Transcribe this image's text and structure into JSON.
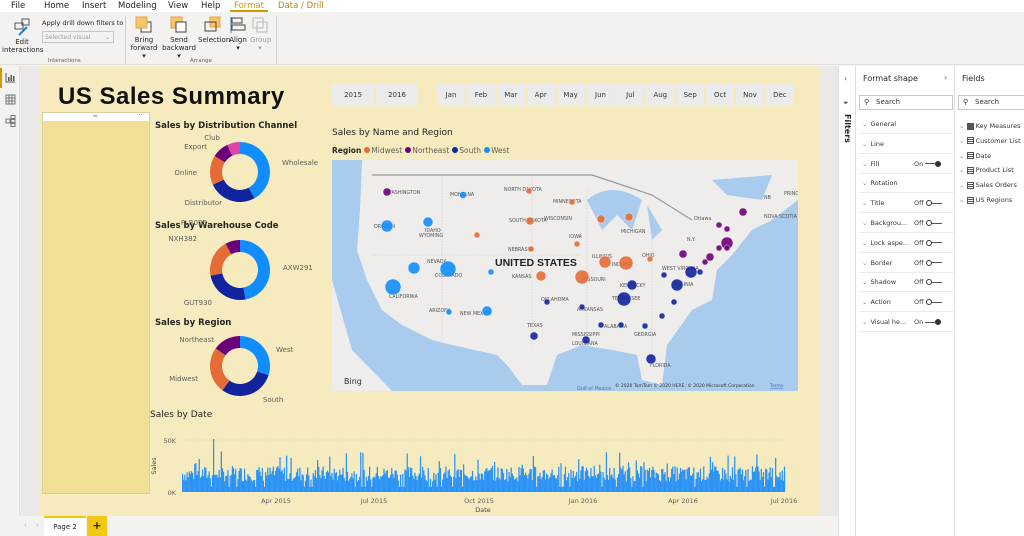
{
  "menu": [
    "File",
    "Home",
    "Insert",
    "Modeling",
    "View",
    "Help",
    "Format",
    "Data / Drill"
  ],
  "ribbon": {
    "edit_interactions": [
      "Edit",
      "interactions"
    ],
    "apply_drill_label": "Apply drill down filters to",
    "apply_drill_value": "Selected visual",
    "group_interactions": "Interactions",
    "bring_forward": [
      "Bring",
      "forward ▾"
    ],
    "send_backward": [
      "Send",
      "backward ▾"
    ],
    "selection": "Selection",
    "align": [
      "Align",
      "▾"
    ],
    "group": [
      "Group",
      "▾"
    ],
    "group_arrange": "Arrange"
  },
  "report": {
    "title": "US Sales Summary",
    "years": [
      "2015",
      "2016"
    ],
    "months": [
      "Jan",
      "Feb",
      "Mar",
      "Apr",
      "May",
      "Jun",
      "Jul",
      "Aug",
      "Sep",
      "Oct",
      "Nov",
      "Dec"
    ]
  },
  "colors": {
    "lightblue": "#118dff",
    "darkblue": "#12239e",
    "orange": "#e66c37",
    "purple": "#6b007b",
    "pink": "#e044a7",
    "page": "#f6ebbe"
  },
  "donuts": [
    {
      "title": "Sales by Distribution Channel",
      "slices": [
        {
          "label": "Wholesale",
          "value": 42,
          "color": "#118dff"
        },
        {
          "label": "Distributor",
          "value": 26,
          "color": "#12239e"
        },
        {
          "label": "Online",
          "value": 16,
          "color": "#e66c37"
        },
        {
          "label": "Export",
          "value": 9,
          "color": "#6b007b"
        },
        {
          "label": "Club",
          "value": 7,
          "color": "#e044a7"
        }
      ]
    },
    {
      "title": "Sales by Warehouse Code",
      "slices": [
        {
          "label": "AXW291",
          "value": 47,
          "color": "#118dff"
        },
        {
          "label": "GUT930",
          "value": 25,
          "color": "#12239e"
        },
        {
          "label": "NXH382",
          "value": 20,
          "color": "#e66c37"
        },
        {
          "label": "FLR025",
          "value": 8,
          "color": "#6b007b"
        }
      ]
    },
    {
      "title": "Sales by Region",
      "slices": [
        {
          "label": "West",
          "value": 30,
          "color": "#118dff"
        },
        {
          "label": "South",
          "value": 30,
          "color": "#12239e"
        },
        {
          "label": "Midwest",
          "value": 25,
          "color": "#e66c37"
        },
        {
          "label": "Northeast",
          "value": 15,
          "color": "#6b007b"
        }
      ]
    }
  ],
  "map": {
    "title": "Sales by Name and Region",
    "legend_title": "Region",
    "legend": [
      {
        "label": "Midwest",
        "color": "#e66c37"
      },
      {
        "label": "Northeast",
        "color": "#6b007b"
      },
      {
        "label": "South",
        "color": "#12239e"
      },
      {
        "label": "West",
        "color": "#118dff"
      }
    ],
    "country_label": "UNITED STATES",
    "labels": [
      "WASHINGTON",
      "MONTANA",
      "OREGON",
      "IDAHO",
      "WYOMING",
      "NEVADA",
      "COLORADO",
      "CALIFORNIA",
      "ARIZONA",
      "NEW MEXICO",
      "NORTH DAKOTA",
      "SOUTH DAKOTA",
      "MINNESOTA",
      "NEBRASKA",
      "IOWA",
      "KANSAS",
      "MISSOURI",
      "ILLINOIS",
      "INDIANA",
      "WISCONSIN",
      "MICHIGAN",
      "OHIO",
      "OKLAHOMA",
      "ARKANSAS",
      "TEXAS",
      "LOUISIANA",
      "MISSISSIPPI",
      "ALABAMA",
      "GEORGIA",
      "TENNESSEE",
      "KENTUCKY",
      "VIRGINIA",
      "WEST VIRGINIA",
      "FLORIDA",
      "N.Y.",
      "Ottawa",
      "NB",
      "PRINCE EDWARD ISLAND",
      "NOVA SCOTIA",
      "Gulf of Mexico"
    ],
    "bing": "Bing",
    "copyright": "© 2020 TomTom © 2020 HERE, © 2020 Microsoft Corporation",
    "terms": "Terms"
  },
  "chart_data": {
    "type": "bar",
    "title": "Sales by Date",
    "xlabel": "Date",
    "ylabel": "Sales",
    "yticks": [
      "0K",
      "50K"
    ],
    "ylim": [
      0,
      50000
    ],
    "xticks": [
      "Apr 2015",
      "Jul 2015",
      "Oct 2015",
      "Jan 2016",
      "Apr 2016",
      "Jul 2016"
    ],
    "x_range": [
      "Jan 2015",
      "Jul 2016"
    ],
    "typical_daily_sales": [
      10000,
      25000
    ],
    "peak": 51000
  },
  "filters_label": "Filters",
  "format_pane": {
    "title": "Format shape",
    "search": "Search",
    "cards": [
      {
        "label": "General"
      },
      {
        "label": "Line"
      },
      {
        "label": "Fill",
        "state": "On"
      },
      {
        "label": "Rotation"
      },
      {
        "label": "Title",
        "state": "Off"
      },
      {
        "label": "Backgrou...",
        "state": "Off"
      },
      {
        "label": "Lock aspe...",
        "state": "Off"
      },
      {
        "label": "Border",
        "state": "Off"
      },
      {
        "label": "Shadow",
        "state": "Off"
      },
      {
        "label": "Action",
        "state": "Off"
      },
      {
        "label": "Visual he...",
        "state": "On"
      }
    ]
  },
  "fields_pane": {
    "title": "Fields",
    "search": "Search",
    "tables": [
      "Key Measures",
      "Customer List",
      "Date",
      "Product List",
      "Sales Orders",
      "US Regions"
    ]
  },
  "pages": {
    "tabs": [
      "Page 2"
    ],
    "add": "+"
  }
}
